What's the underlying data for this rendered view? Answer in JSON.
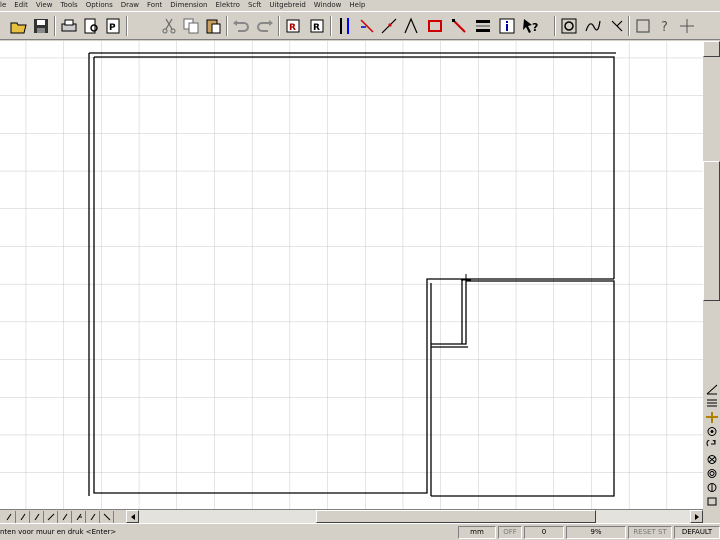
{
  "menu": [
    "le",
    "Edit",
    "View",
    "Tools",
    "Options",
    "Draw",
    "Font",
    "Dimension",
    "Elektro",
    "Scft",
    "Uitgebreid",
    "Window",
    "Help"
  ],
  "toolbar": {
    "icons": [
      "open-folder-icon",
      "save-icon",
      "print-icon",
      "print-preview-icon",
      "pdf-export-icon",
      "cut-icon",
      "copy-icon",
      "paste-icon",
      "undo-icon",
      "redo-icon",
      "insert-r-icon",
      "insert-r2-icon",
      "parallel-lines-icon",
      "wall-corner-icon",
      "line-pen-icon",
      "line-pen2-icon",
      "rectangle-select-icon",
      "diagonal-line-icon",
      "layers-icon",
      "info-icon",
      "help-pointer-icon",
      "zoom-window-icon",
      "curve-icon",
      "square-icon",
      "question-icon",
      "crosshair-icon",
      "extra-icon"
    ]
  },
  "sidetools": {
    "icons": [
      "measure-angle-icon",
      "align-horizontal-icon",
      "grid-add-icon",
      "snap-icon",
      "rotate-icon",
      "target-icon",
      "circle-icon",
      "eye-icon",
      "mirror-icon"
    ]
  },
  "tabs": {
    "icons": [
      "tab-icon-1",
      "tab-icon-2",
      "tab-icon-3",
      "tab-icon-4",
      "tab-icon-5",
      "tab-icon-6",
      "tab-icon-7",
      "tab-icon-8"
    ]
  },
  "status": {
    "prompt": "nten voor muur en druk <Enter>",
    "unit": "mm",
    "snap": "OFF",
    "angle": "0",
    "zoom": "9%",
    "reset": "RESET ST",
    "layer": "DEFAULT"
  }
}
